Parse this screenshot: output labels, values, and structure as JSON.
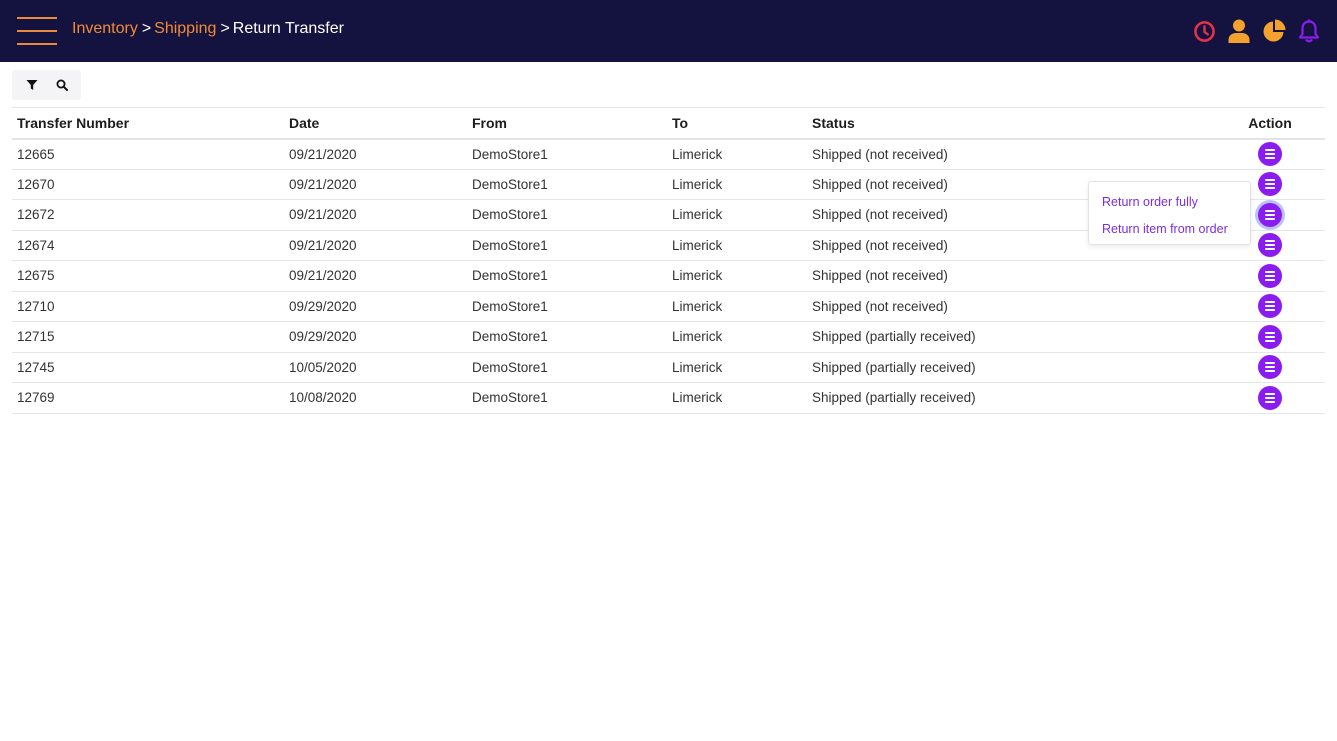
{
  "breadcrumb": {
    "items": [
      "Inventory",
      "Shipping"
    ],
    "separator": ">",
    "current": "Return Transfer"
  },
  "header_icons": [
    {
      "name": "clock-icon",
      "color": "#e8324a"
    },
    {
      "name": "user-icon",
      "color": "#f4a12e"
    },
    {
      "name": "pie-chart-icon",
      "color": "#f4a12e"
    },
    {
      "name": "bell-icon",
      "color": "#8a1cf0"
    }
  ],
  "toolbar": {
    "filter_icon": "filter-icon",
    "search_icon": "search-icon"
  },
  "table": {
    "columns": [
      "Transfer Number",
      "Date",
      "From",
      "To",
      "Status",
      "Action"
    ],
    "rows": [
      [
        "12665",
        "09/21/2020",
        "DemoStore1",
        "Limerick",
        "Shipped (not received)"
      ],
      [
        "12670",
        "09/21/2020",
        "DemoStore1",
        "Limerick",
        "Shipped (not received)"
      ],
      [
        "12672",
        "09/21/2020",
        "DemoStore1",
        "Limerick",
        "Shipped (not received)"
      ],
      [
        "12674",
        "09/21/2020",
        "DemoStore1",
        "Limerick",
        "Shipped (not received)"
      ],
      [
        "12675",
        "09/21/2020",
        "DemoStore1",
        "Limerick",
        "Shipped (not received)"
      ],
      [
        "12710",
        "09/29/2020",
        "DemoStore1",
        "Limerick",
        "Shipped (not received)"
      ],
      [
        "12715",
        "09/29/2020",
        "DemoStore1",
        "Limerick",
        "Shipped (partially received)"
      ],
      [
        "12745",
        "10/05/2020",
        "DemoStore1",
        "Limerick",
        "Shipped (partially received)"
      ],
      [
        "12769",
        "10/08/2020",
        "DemoStore1",
        "Limerick",
        "Shipped (partially received)"
      ]
    ]
  },
  "action_menu": {
    "open_row": 2,
    "items": [
      "Return order fully",
      "Return item from order"
    ]
  },
  "colors": {
    "header_bg": "#14133f",
    "breadcrumb_link": "#f28a35",
    "accent_purple": "#8a1cf0",
    "menu_text": "#7b2ee0"
  }
}
